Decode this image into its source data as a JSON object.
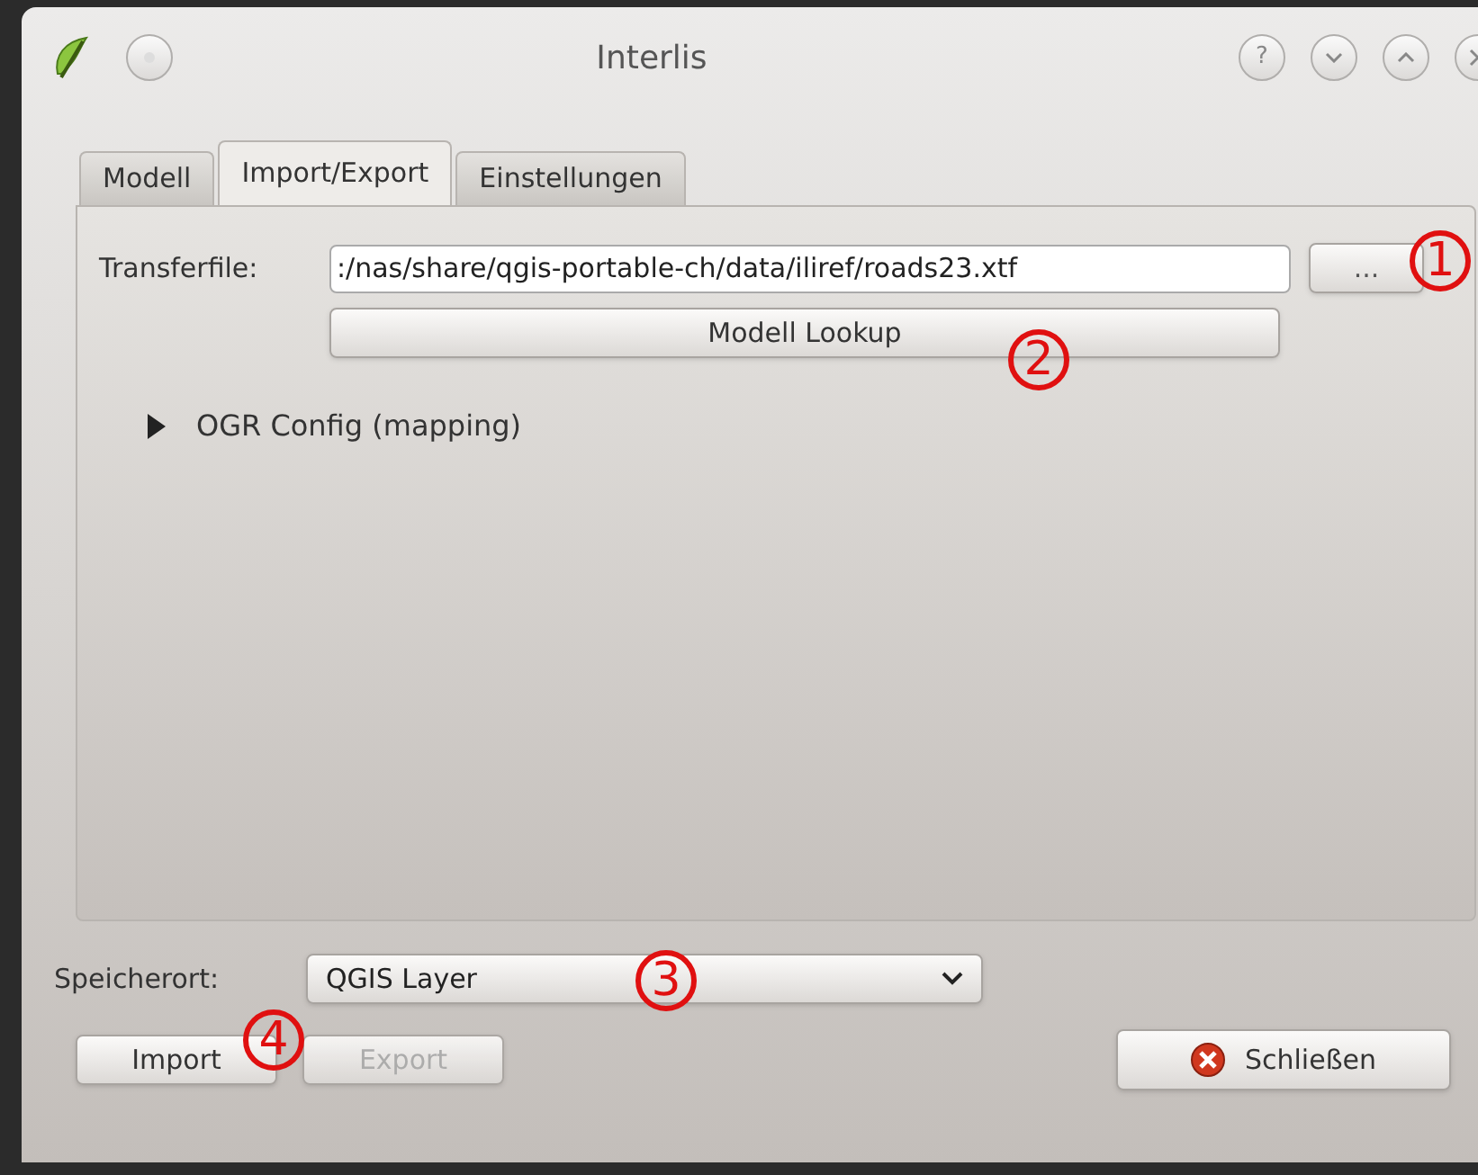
{
  "window": {
    "title": "Interlis",
    "help_glyph": "?"
  },
  "tabs": [
    {
      "label": "Modell",
      "selected": false
    },
    {
      "label": "Import/Export",
      "selected": true
    },
    {
      "label": "Einstellungen",
      "selected": false
    }
  ],
  "transferfile": {
    "label": "Transferfile:",
    "value": ":/nas/share/qgis-portable-ch/data/iliref/roads23.xtf",
    "browse": "..."
  },
  "lookup_button": "Modell Lookup",
  "ogr_config": {
    "label": "OGR Config (mapping)",
    "expanded": false
  },
  "speicherort": {
    "label": "Speicherort:",
    "value": "QGIS Layer"
  },
  "buttons": [
    {
      "label": "Import",
      "disabled": false
    },
    {
      "label": "Export",
      "disabled": true
    }
  ],
  "close_button": "Schließen",
  "annotations": [
    "1",
    "2",
    "3",
    "4"
  ]
}
